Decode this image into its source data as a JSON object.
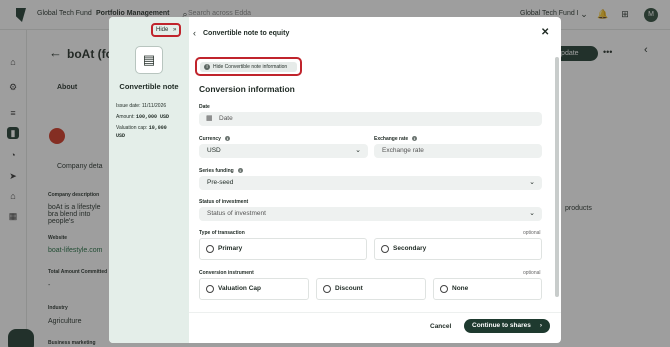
{
  "topbar": {
    "org": "Global Tech Fund",
    "section": "Portfolio Management",
    "search_placeholder": "Search across Edda",
    "fund_selector": "Global Tech Fund I",
    "avatar": "M"
  },
  "background": {
    "company_title": "boAt (fo",
    "tab_about": "About",
    "update_button": "Update",
    "labels": {
      "company_description": "Company description",
      "website": "Website",
      "total_amount": "Total Amount Committed",
      "industry": "Industry",
      "business_marketing": "Business marketing"
    },
    "values": {
      "description": "boAt is a lifestyle bra blend into people's",
      "website": "boat-lifestyle.com",
      "total_amount": "-",
      "industry": "Agriculture",
      "right_fragment": "products",
      "company_details": "Company deta"
    }
  },
  "left_panel": {
    "hide_label": "Hide",
    "title": "Convertible note",
    "issue_date": "Issue date: 11/11/2026",
    "amount_label": "Amount:",
    "amount_value": "100,000 USD",
    "valuation_label": "Valuation cap:",
    "valuation_value": "10,000",
    "valuation_currency": "USD"
  },
  "modal": {
    "title": "Convertible note to equity",
    "hide_info": "Hide Convertible note information",
    "section_title": "Conversion information",
    "date_label": "Date",
    "date_placeholder": "Date",
    "currency_label": "Currency",
    "currency_value": "USD",
    "exchange_label": "Exchange rate",
    "exchange_placeholder": "Exchange rate",
    "series_label": "Series funding",
    "series_value": "Pre-seed",
    "status_label": "Status of investment",
    "status_placeholder": "Status of investment",
    "transaction_label": "Type of transaction",
    "optional": "optional",
    "transaction_options": [
      "Primary",
      "Secondary"
    ],
    "instrument_label": "Conversion instrument",
    "instrument_options": [
      "Valuation Cap",
      "Discount",
      "None"
    ],
    "cancel": "Cancel",
    "continue": "Continue to shares"
  }
}
